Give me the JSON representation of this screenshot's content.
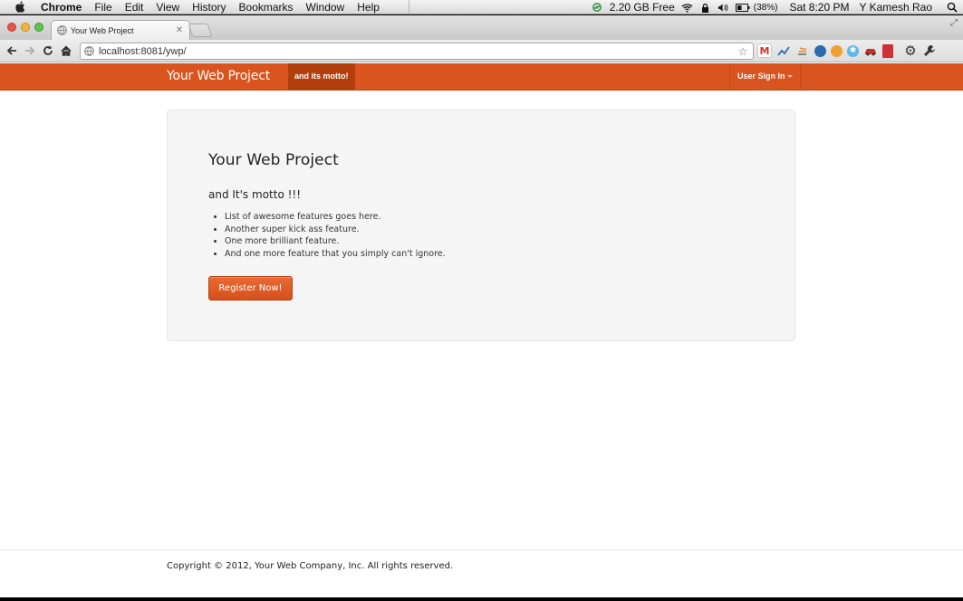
{
  "menubar": {
    "app": "Chrome",
    "items": [
      "File",
      "Edit",
      "View",
      "History",
      "Bookmarks",
      "Window",
      "Help"
    ],
    "disk": "2.20 GB Free",
    "battery": "(38%)",
    "clock": "Sat 8:20 PM",
    "user": "Y Kamesh Rao"
  },
  "browser": {
    "tab_title": "Your Web Project",
    "url": "localhost:8081/ywp/"
  },
  "navbar": {
    "brand": "Your Web Project",
    "motto": "and its motto!",
    "signin": "User Sign In"
  },
  "hero": {
    "title": "Your Web Project",
    "subtitle": "and It's motto !!!",
    "features": [
      "List of awesome features goes here.",
      "Another super kick ass feature.",
      "One more brilliant feature.",
      "And one more feature that you simply can't ignore."
    ],
    "cta": "Register Now!"
  },
  "footer": {
    "copyright": "Copyright © 2012, Your Web Company, Inc. All rights reserved."
  },
  "colors": {
    "accent": "#d9541e",
    "accent_dark": "#b33f0c",
    "hero_bg": "#f5f5f5"
  }
}
